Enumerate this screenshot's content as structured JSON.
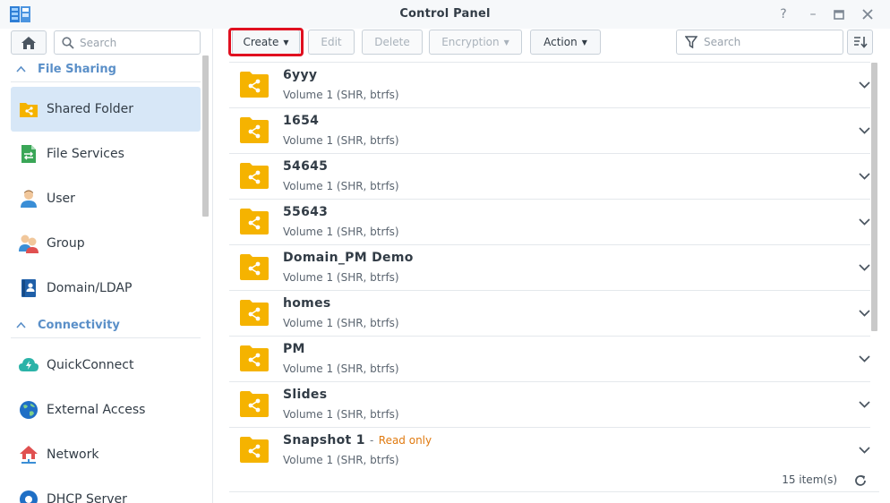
{
  "window": {
    "title": "Control Panel",
    "help_label": "?",
    "minimize_label": "–",
    "maximize_label": "□",
    "close_label": "×"
  },
  "sidebar": {
    "search_placeholder": "Search",
    "sections": [
      {
        "label": "File Sharing"
      },
      {
        "label": "Connectivity"
      }
    ],
    "items": [
      {
        "label": "Shared Folder",
        "icon": "shared-folder-icon",
        "active": true
      },
      {
        "label": "File Services",
        "icon": "file-services-icon"
      },
      {
        "label": "User",
        "icon": "user-icon"
      },
      {
        "label": "Group",
        "icon": "group-icon"
      },
      {
        "label": "Domain/LDAP",
        "icon": "domain-ldap-icon"
      },
      {
        "label": "QuickConnect",
        "icon": "quickconnect-icon"
      },
      {
        "label": "External Access",
        "icon": "external-access-icon"
      },
      {
        "label": "Network",
        "icon": "network-icon"
      },
      {
        "label": "DHCP Server",
        "icon": "dhcp-server-icon"
      }
    ]
  },
  "toolbar": {
    "create": "Create",
    "edit": "Edit",
    "delete": "Delete",
    "encryption": "Encryption",
    "action": "Action",
    "search_placeholder": "Search"
  },
  "folders": [
    {
      "name": "6yyy",
      "location": "Volume 1 (SHR, btrfs)"
    },
    {
      "name": "1654",
      "location": "Volume 1 (SHR, btrfs)"
    },
    {
      "name": "54645",
      "location": "Volume 1 (SHR, btrfs)"
    },
    {
      "name": "55643",
      "location": "Volume 1 (SHR, btrfs)"
    },
    {
      "name": "Domain_PM Demo",
      "location": "Volume 1 (SHR, btrfs)"
    },
    {
      "name": "homes",
      "location": "Volume 1 (SHR, btrfs)"
    },
    {
      "name": "PM",
      "location": "Volume 1 (SHR, btrfs)"
    },
    {
      "name": "Slides",
      "location": "Volume 1 (SHR, btrfs)"
    },
    {
      "name": "Snapshot 1",
      "status_sep": "-",
      "status": "Read only",
      "location": "Volume 1 (SHR, btrfs)"
    }
  ],
  "footer": {
    "item_count": "15 item(s)"
  },
  "colors": {
    "accent": "#5a8fc8",
    "folder": "#f5b300",
    "highlight": "#e01020",
    "readonly": "#e07a10",
    "active_bg": "#d7e7f7"
  }
}
